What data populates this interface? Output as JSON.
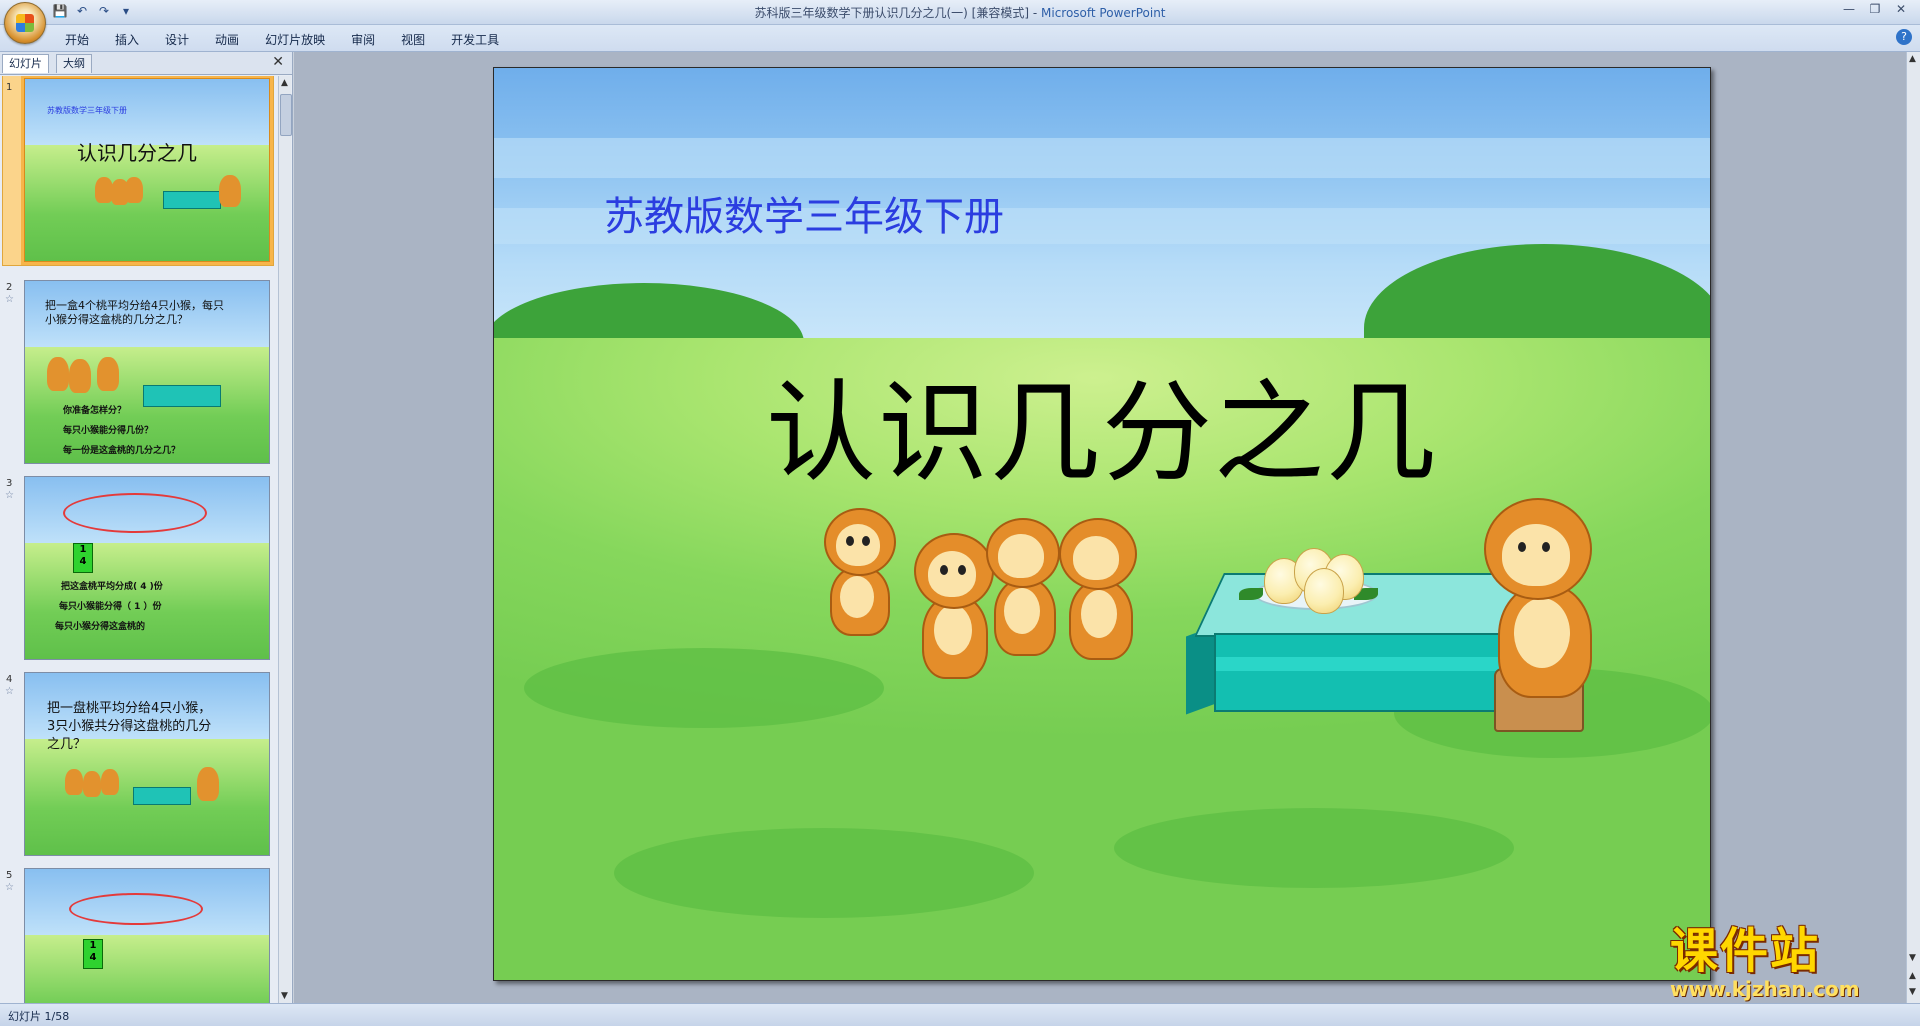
{
  "window": {
    "title": "苏科版三年级数学下册认识几分之几(一) [兼容模式] - ",
    "app": "Microsoft PowerPoint"
  },
  "ribbon": {
    "tabs": [
      "开始",
      "插入",
      "设计",
      "动画",
      "幻灯片放映",
      "审阅",
      "视图",
      "开发工具"
    ]
  },
  "panel": {
    "tab_slides": "幻灯片",
    "tab_outline": "大纲"
  },
  "thumbnails": [
    {
      "num": "1",
      "subtitle": "苏教版数学三年级下册",
      "title": "认识几分之几"
    },
    {
      "num": "2",
      "line1": "把一盒4个桃平均分给4只小猴，每只",
      "line2": "小猴分得这盒桃的几分之几？",
      "q1": "你准备怎样分？",
      "q2": "每只小猴能分得几份？",
      "q3": "每一份是这盒桃的几分之几？"
    },
    {
      "num": "3",
      "frac_top": "1",
      "frac_bottom": "4",
      "l1": "把这盒桃平均分成( 4 )份",
      "l2": "每只小猴能分得（ 1 ）份",
      "l3": "每只小猴分得这盒桃的"
    },
    {
      "num": "4",
      "line1": "把一盘桃平均分给4只小猴，",
      "line2": "3只小猴共分得这盘桃的几分",
      "line3": "之几？"
    },
    {
      "num": "5",
      "frac_top": "1",
      "frac_bottom": "4"
    }
  ],
  "slide": {
    "subtitle": "苏教版数学三年级下册",
    "title": "认识几分之几"
  },
  "watermark": {
    "brand": "课件站",
    "url": "www.kjzhan.com"
  },
  "status": {
    "slide_info": "幻灯片 1/58"
  }
}
